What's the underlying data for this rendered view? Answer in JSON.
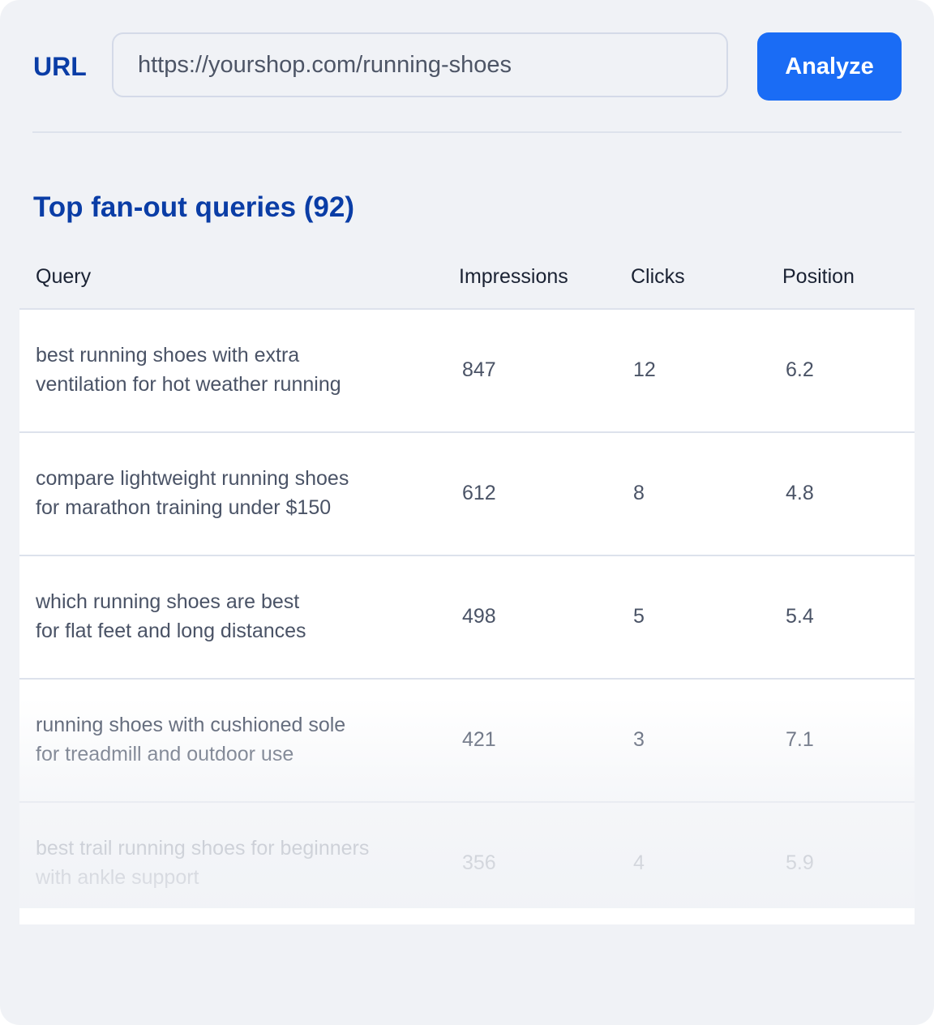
{
  "url_bar": {
    "label": "URL",
    "value": "https://yourshop.com/running-shoes",
    "button_label": "Analyze"
  },
  "section": {
    "title": "Top fan-out queries (92)"
  },
  "table": {
    "headers": {
      "query": "Query",
      "impressions": "Impressions",
      "clicks": "Clicks",
      "position": "Position"
    },
    "rows": [
      {
        "query_line1": "best running shoes with extra",
        "query_line2": "ventilation for hot weather running",
        "impressions": "847",
        "clicks": "12",
        "position": "6.2"
      },
      {
        "query_line1": "compare lightweight running shoes",
        "query_line2": "for marathon training under $150",
        "impressions": "612",
        "clicks": "8",
        "position": "4.8"
      },
      {
        "query_line1": "which running shoes are best",
        "query_line2": "for flat feet and long distances",
        "impressions": "498",
        "clicks": "5",
        "position": "5.4"
      },
      {
        "query_line1": "running shoes with cushioned sole",
        "query_line2": "for treadmill and outdoor use",
        "impressions": "421",
        "clicks": "3",
        "position": "7.1"
      },
      {
        "query_line1": "best trail running shoes for beginners",
        "query_line2": "with ankle support",
        "impressions": "356",
        "clicks": "4",
        "position": "5.9"
      }
    ]
  },
  "colors": {
    "accent": "#1a6cf5",
    "heading": "#0a3da6",
    "background": "#f0f2f6"
  }
}
